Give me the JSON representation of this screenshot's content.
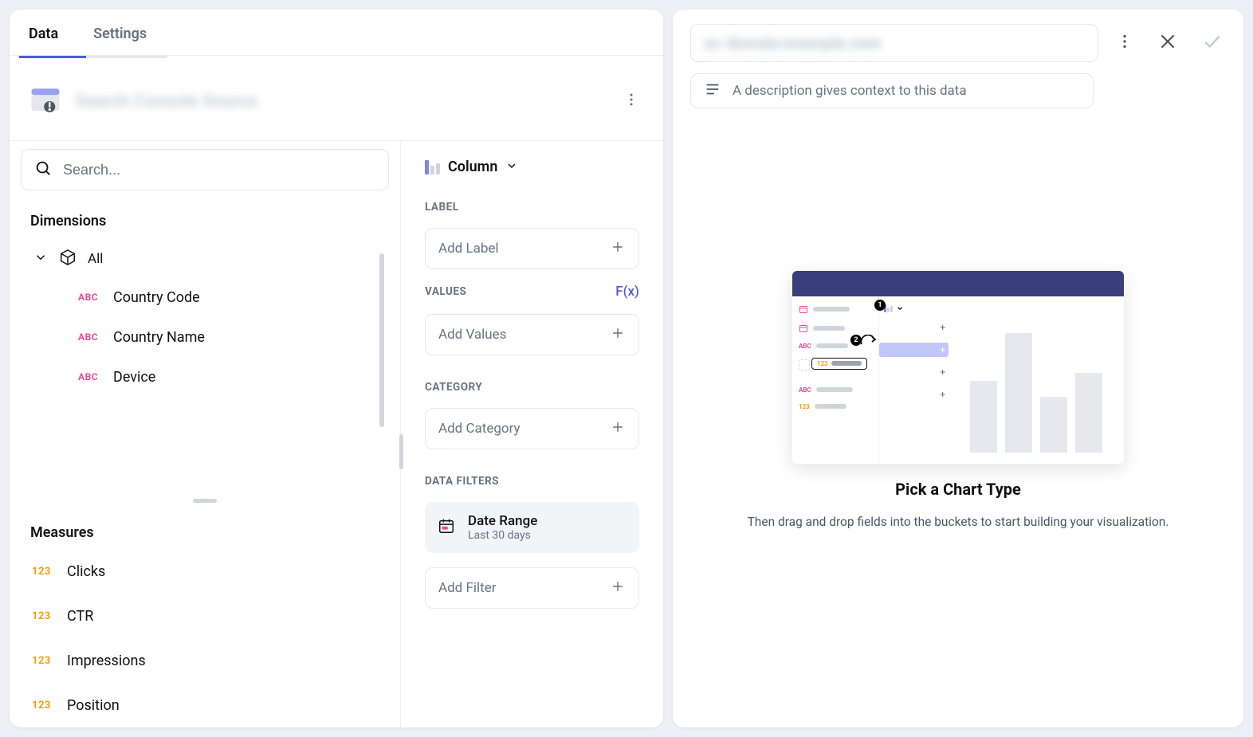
{
  "tabs": {
    "data": "Data",
    "settings": "Settings"
  },
  "source": {
    "name": "Search Console Source"
  },
  "search": {
    "placeholder": "Search..."
  },
  "sections": {
    "dimensions": "Dimensions",
    "measures": "Measures"
  },
  "dimensions": {
    "all": "All",
    "items": [
      "Country Code",
      "Country Name",
      "Device"
    ]
  },
  "measures": {
    "items": [
      "Clicks",
      "CTR",
      "Impressions",
      "Position"
    ]
  },
  "config": {
    "chartType": "Column",
    "label": "LABEL",
    "addLabel": "Add Label",
    "values": "VALUES",
    "fx": "F(x)",
    "addValues": "Add Values",
    "category": "CATEGORY",
    "addCategory": "Add Category",
    "dataFilters": "DATA FILTERS",
    "dateRange": {
      "title": "Date Range",
      "sub": "Last 30 days"
    },
    "addFilter": "Add Filter"
  },
  "right": {
    "title": "sc-domain:example.com",
    "descPlaceholder": "A description gives context to this data",
    "canvasTitle": "Pick a Chart Type",
    "canvasSub": "Then drag and drop fields into the buckets to start building your visualization."
  },
  "fieldTypes": {
    "abc": "ABC",
    "num": "123"
  }
}
